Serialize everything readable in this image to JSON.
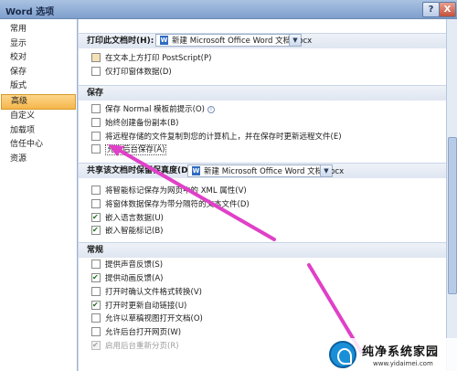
{
  "window": {
    "title": "Word 选项",
    "help_label": "?",
    "close_label": "X"
  },
  "sidebar": {
    "items": [
      {
        "label": "常用"
      },
      {
        "label": "显示"
      },
      {
        "label": "校对"
      },
      {
        "label": "保存"
      },
      {
        "label": "版式"
      },
      {
        "label": "高级",
        "active": true
      },
      {
        "label": "自定义"
      },
      {
        "label": "加载项"
      },
      {
        "label": "信任中心"
      },
      {
        "label": "资源"
      }
    ]
  },
  "print_section": {
    "label": "打印此文档时(H):",
    "document": "新建 Microsoft Office Word 文档.docx",
    "options": [
      {
        "label": "在文本上方打印 PostScript(P)",
        "checked": false,
        "disabled": false
      },
      {
        "label": "仅打印窗体数据(D)",
        "checked": false,
        "disabled": false
      }
    ]
  },
  "save_section": {
    "title": "保存",
    "options": [
      {
        "label": "保存 Normal 模板前提示(O)",
        "checked": false,
        "info": true
      },
      {
        "label": "始终创建备份副本(B)",
        "checked": false
      },
      {
        "label": "将远程存储的文件复制到您的计算机上，并在保存时更新远程文件(E)",
        "checked": false
      },
      {
        "label": "允许后台保存(A)",
        "checked": false
      }
    ]
  },
  "share_section": {
    "label": "共享该文档时保留保真度(D):",
    "document": "新建 Microsoft Office Word 文档.docx",
    "options": [
      {
        "label": "将智能标记保存为网页中的 XML 属性(V)",
        "checked": false
      },
      {
        "label": "将窗体数据保存为带分隔符的文本文件(D)",
        "checked": false
      },
      {
        "label": "嵌入语言数据(U)",
        "checked": true
      },
      {
        "label": "嵌入智能标记(B)",
        "checked": true
      }
    ]
  },
  "general_section": {
    "title": "常规",
    "options": [
      {
        "label": "提供声音反馈(S)",
        "checked": false,
        "disabled": false
      },
      {
        "label": "提供动画反馈(A)",
        "checked": true,
        "disabled": false
      },
      {
        "label": "打开时确认文件格式转换(V)",
        "checked": false,
        "disabled": false
      },
      {
        "label": "打开时更新自动链接(U)",
        "checked": true,
        "disabled": false
      },
      {
        "label": "允许以草稿视图打开文档(O)",
        "checked": false,
        "disabled": false
      },
      {
        "label": "允许后台打开网页(W)",
        "checked": false,
        "disabled": false
      },
      {
        "label": "启用后台重新分页(R)",
        "checked": true,
        "disabled": true
      }
    ]
  },
  "icons": {
    "dropdown": "chevron-down-icon",
    "document": "word-document-icon",
    "info": "info-icon"
  },
  "colors": {
    "active_tab": "#f6b64c",
    "annotation_arrow": "#e040c8",
    "titlebar": "#7f9fcc"
  },
  "watermark": {
    "name": "纯净系统家园",
    "url": "www.yidaimei.com"
  }
}
